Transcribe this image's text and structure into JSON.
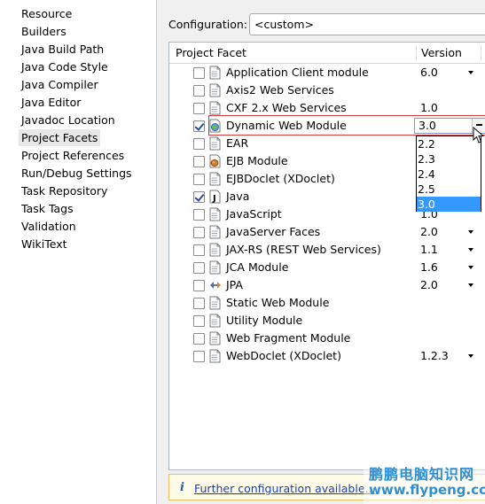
{
  "nav": {
    "items": [
      {
        "label": "Resource",
        "selected": false
      },
      {
        "label": "Builders",
        "selected": false
      },
      {
        "label": "Java Build Path",
        "selected": false
      },
      {
        "label": "Java Code Style",
        "selected": false
      },
      {
        "label": "Java Compiler",
        "selected": false
      },
      {
        "label": "Java Editor",
        "selected": false
      },
      {
        "label": "Javadoc Location",
        "selected": false
      },
      {
        "label": "Project Facets",
        "selected": true
      },
      {
        "label": "Project References",
        "selected": false
      },
      {
        "label": "Run/Debug Settings",
        "selected": false
      },
      {
        "label": "Task Repository",
        "selected": false
      },
      {
        "label": "Task Tags",
        "selected": false
      },
      {
        "label": "Validation",
        "selected": false
      },
      {
        "label": "WikiText",
        "selected": false
      }
    ]
  },
  "config": {
    "label": "Configuration:",
    "value": "<custom>"
  },
  "table": {
    "col_facet": "Project Facet",
    "col_version": "Version",
    "rows": [
      {
        "name": "Application Client module",
        "version": "6.0",
        "checked": false,
        "dropdown": true,
        "icon": "document-icon"
      },
      {
        "name": "Axis2 Web Services",
        "version": "",
        "checked": false,
        "dropdown": false,
        "icon": "document-icon"
      },
      {
        "name": "CXF 2.x Web Services",
        "version": "1.0",
        "checked": false,
        "dropdown": false,
        "icon": "document-icon"
      },
      {
        "name": "Dynamic Web Module",
        "version": "3.0",
        "checked": true,
        "dropdown": false,
        "icon": "globe-icon"
      },
      {
        "name": "EAR",
        "version": "",
        "checked": false,
        "dropdown": false,
        "icon": "document-icon"
      },
      {
        "name": "EJB Module",
        "version": "",
        "checked": false,
        "dropdown": false,
        "icon": "bean-icon"
      },
      {
        "name": "EJBDoclet (XDoclet)",
        "version": "",
        "checked": false,
        "dropdown": false,
        "icon": "document-icon"
      },
      {
        "name": "Java",
        "version": "",
        "checked": true,
        "dropdown": false,
        "icon": "java-icon"
      },
      {
        "name": "JavaScript",
        "version": "1.0",
        "checked": false,
        "dropdown": false,
        "icon": "document-icon"
      },
      {
        "name": "JavaServer Faces",
        "version": "2.0",
        "checked": false,
        "dropdown": true,
        "icon": "document-icon"
      },
      {
        "name": "JAX-RS (REST Web Services)",
        "version": "1.1",
        "checked": false,
        "dropdown": true,
        "icon": "document-icon"
      },
      {
        "name": "JCA Module",
        "version": "1.6",
        "checked": false,
        "dropdown": true,
        "icon": "document-icon"
      },
      {
        "name": "JPA",
        "version": "2.0",
        "checked": false,
        "dropdown": true,
        "icon": "jpa-icon"
      },
      {
        "name": "Static Web Module",
        "version": "",
        "checked": false,
        "dropdown": false,
        "icon": "document-icon"
      },
      {
        "name": "Utility Module",
        "version": "",
        "checked": false,
        "dropdown": false,
        "icon": "document-icon"
      },
      {
        "name": "Web Fragment Module",
        "version": "",
        "checked": false,
        "dropdown": false,
        "icon": "document-icon"
      },
      {
        "name": "WebDoclet (XDoclet)",
        "version": "1.2.3",
        "checked": false,
        "dropdown": true,
        "icon": "document-icon"
      }
    ]
  },
  "version_dropdown": {
    "current": "3.0",
    "options": [
      "2.2",
      "2.3",
      "2.4",
      "2.5",
      "3.0"
    ],
    "selected": "3.0"
  },
  "footer": {
    "icon": "info-icon",
    "link": "Further configuration available..."
  },
  "watermark": {
    "text_cn": "鹏鹏电脑知识网",
    "url": "www.flypeng.com"
  },
  "colors": {
    "selection_blue": "#3399ff",
    "edit_outline": "#d23b3b",
    "link": "#1a3fb5"
  }
}
